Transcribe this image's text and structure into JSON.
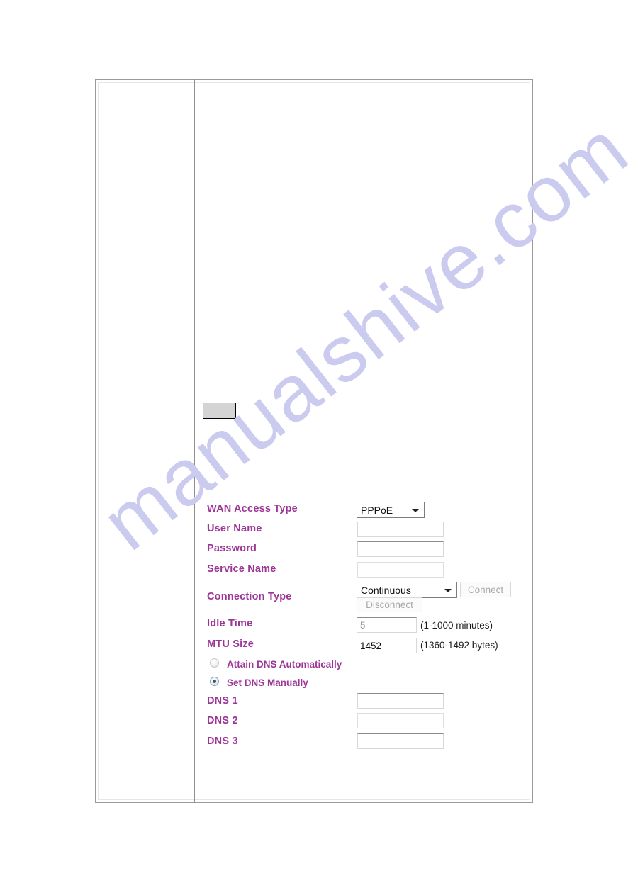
{
  "watermark": {
    "text": "manualshive.com",
    "color": "#cbcbef"
  },
  "theme": {
    "label_color": "#9c3596",
    "hint_color": "#1c1c1c",
    "disabled_text": "#a8a8a8",
    "frame_border": "#9a9a9a"
  },
  "form": {
    "title_button_label": "",
    "fields": {
      "wan_access_type": {
        "label": "WAN Access Type",
        "value": "PPPoE",
        "options": [
          "PPPoE"
        ]
      },
      "user_name": {
        "label": "User Name",
        "value": "",
        "placeholder": ""
      },
      "password": {
        "label": "Password",
        "value": "",
        "placeholder": ""
      },
      "service_name": {
        "label": "Service Name",
        "value": "",
        "placeholder": ""
      },
      "connection_type": {
        "label": "Connection Type",
        "value": "Continuous",
        "options": [
          "Continuous"
        ],
        "connect_button": "Connect",
        "disconnect_button": "Disconnect"
      },
      "idle_time": {
        "label": "Idle Time",
        "value": "5",
        "hint": "(1-1000 minutes)"
      },
      "mtu_size": {
        "label": "MTU Size",
        "value": "1452",
        "hint": "(1360-1492 bytes)"
      },
      "dns_mode": {
        "attain_label": "Attain DNS Automatically",
        "manual_label": "Set DNS Manually",
        "selected": "manual"
      },
      "dns1": {
        "label": "DNS 1",
        "value": ""
      },
      "dns2": {
        "label": "DNS 2",
        "value": ""
      },
      "dns3": {
        "label": "DNS 3",
        "value": ""
      }
    }
  }
}
